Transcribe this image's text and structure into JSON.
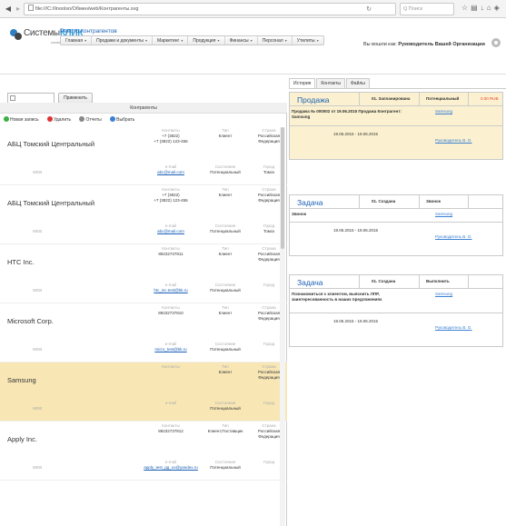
{
  "browser": {
    "url": "file:///C:/Ilnoolsn/Обмен/web/Контрагенты.svg",
    "search_placeholder": "Q Поиск"
  },
  "header": {
    "logo_main": "Системы",
    "logo_accent": "КЛИК",
    "logo_sub": "солюшн",
    "page_title": "Реестр контрагентов",
    "user_prefix": "Вы вошли как:",
    "user_name": "Руководитель Вашей Организации"
  },
  "menu": [
    "Главная",
    "Продажи и документы",
    "Маркетинг",
    "Продукция",
    "Финансы",
    "Персонал",
    "Утилиты"
  ],
  "filter": {
    "apply_label": "Применить"
  },
  "list": {
    "header": "Контрагенты",
    "toolbar": [
      "Новая запись",
      "Удалить",
      "Отчеты",
      "Выбрать"
    ],
    "labels": {
      "contacts": "Контакты",
      "type": "Тип",
      "country": "Страна",
      "email": "e-mail",
      "status": "Состояние",
      "city": "Город",
      "www": "WEB"
    },
    "records": [
      {
        "name": "АБЦ Томский Центральный",
        "phone1": "+7 (3822)",
        "phone2": "+7 (3822) 123-456",
        "type": "Клиент",
        "country": "Российская Федерация",
        "email": "abc@mail.com",
        "status": "Потенциальный",
        "city": "Томск",
        "selected": false
      },
      {
        "name": "АБЦ Томский Центральный",
        "phone1": "+7 (3822)",
        "phone2": "+7 (3822) 123-456",
        "type": "Клиент",
        "country": "Российская Федерация",
        "email": "abc@mail.com",
        "status": "Потенциальный",
        "city": "Томск",
        "selected": false
      },
      {
        "name": "HTC Inc.",
        "phone1": "89232737811",
        "phone2": "",
        "type": "Клиент",
        "country": "Российская Федерация",
        "email": "htc_inc.test@bk.ru",
        "status": "Потенциальный",
        "city": "",
        "selected": false
      },
      {
        "name": "Microsoft Corp.",
        "phone1": "89232737810",
        "phone2": "",
        "type": "Клиент",
        "country": "Российская Федерация",
        "email": "micro_test@bk.ru",
        "status": "Потенциальный",
        "city": "",
        "selected": false
      },
      {
        "name": "Samsung",
        "phone1": "",
        "phone2": "",
        "type": "Клиент",
        "country": "Российская Федерация",
        "email": "",
        "status": "Потенциальный",
        "city": "",
        "selected": true
      },
      {
        "name": "Apply Inc.",
        "phone1": "89232737812",
        "phone2": "",
        "type": "Клиент,Поставщик",
        "country": "Российская Федерация",
        "email": "apply_test_gg_xo@yandex.ru",
        "status": "Потенциальный",
        "city": "",
        "selected": false
      }
    ]
  },
  "right": {
    "tabs": [
      "История",
      "Контакты",
      "Файлы"
    ],
    "cards": [
      {
        "kind": "Продажа",
        "state": "01. Запланирована",
        "extra": "Потенциальный",
        "amount": "0.00 RUB",
        "desc": "Продажа № 000002 от 19.06.2015 Продажа Контрагент: Samsung",
        "client": "Samsung",
        "dates": "19.06.2015 - 19.06.2015",
        "resp": "Руководитель В. О.",
        "sale": true
      },
      {
        "kind": "Задача",
        "state": "01. Создана",
        "extra": "Звонок",
        "amount": "",
        "desc": "Звонок",
        "client": "Samsung",
        "dates": "19.06.2015 - 19.06.2015",
        "resp": "Руководитель В. О.",
        "sale": false
      },
      {
        "kind": "Задача",
        "state": "01. Создана",
        "extra": "Выполнить",
        "amount": "",
        "desc": "Познакомиться с клиентом, выяснить ЛПР, заинтересованность в наших предложениях",
        "client": "Samsung",
        "dates": "19.06.2015 - 19.06.2015",
        "resp": "Руководитель В. О.",
        "sale": false
      }
    ]
  },
  "colors": {
    "link": "#1a5fb4",
    "selected_row": "#f8e7b5",
    "sale_card": "#fbf1d0",
    "amount": "#e8432b"
  }
}
